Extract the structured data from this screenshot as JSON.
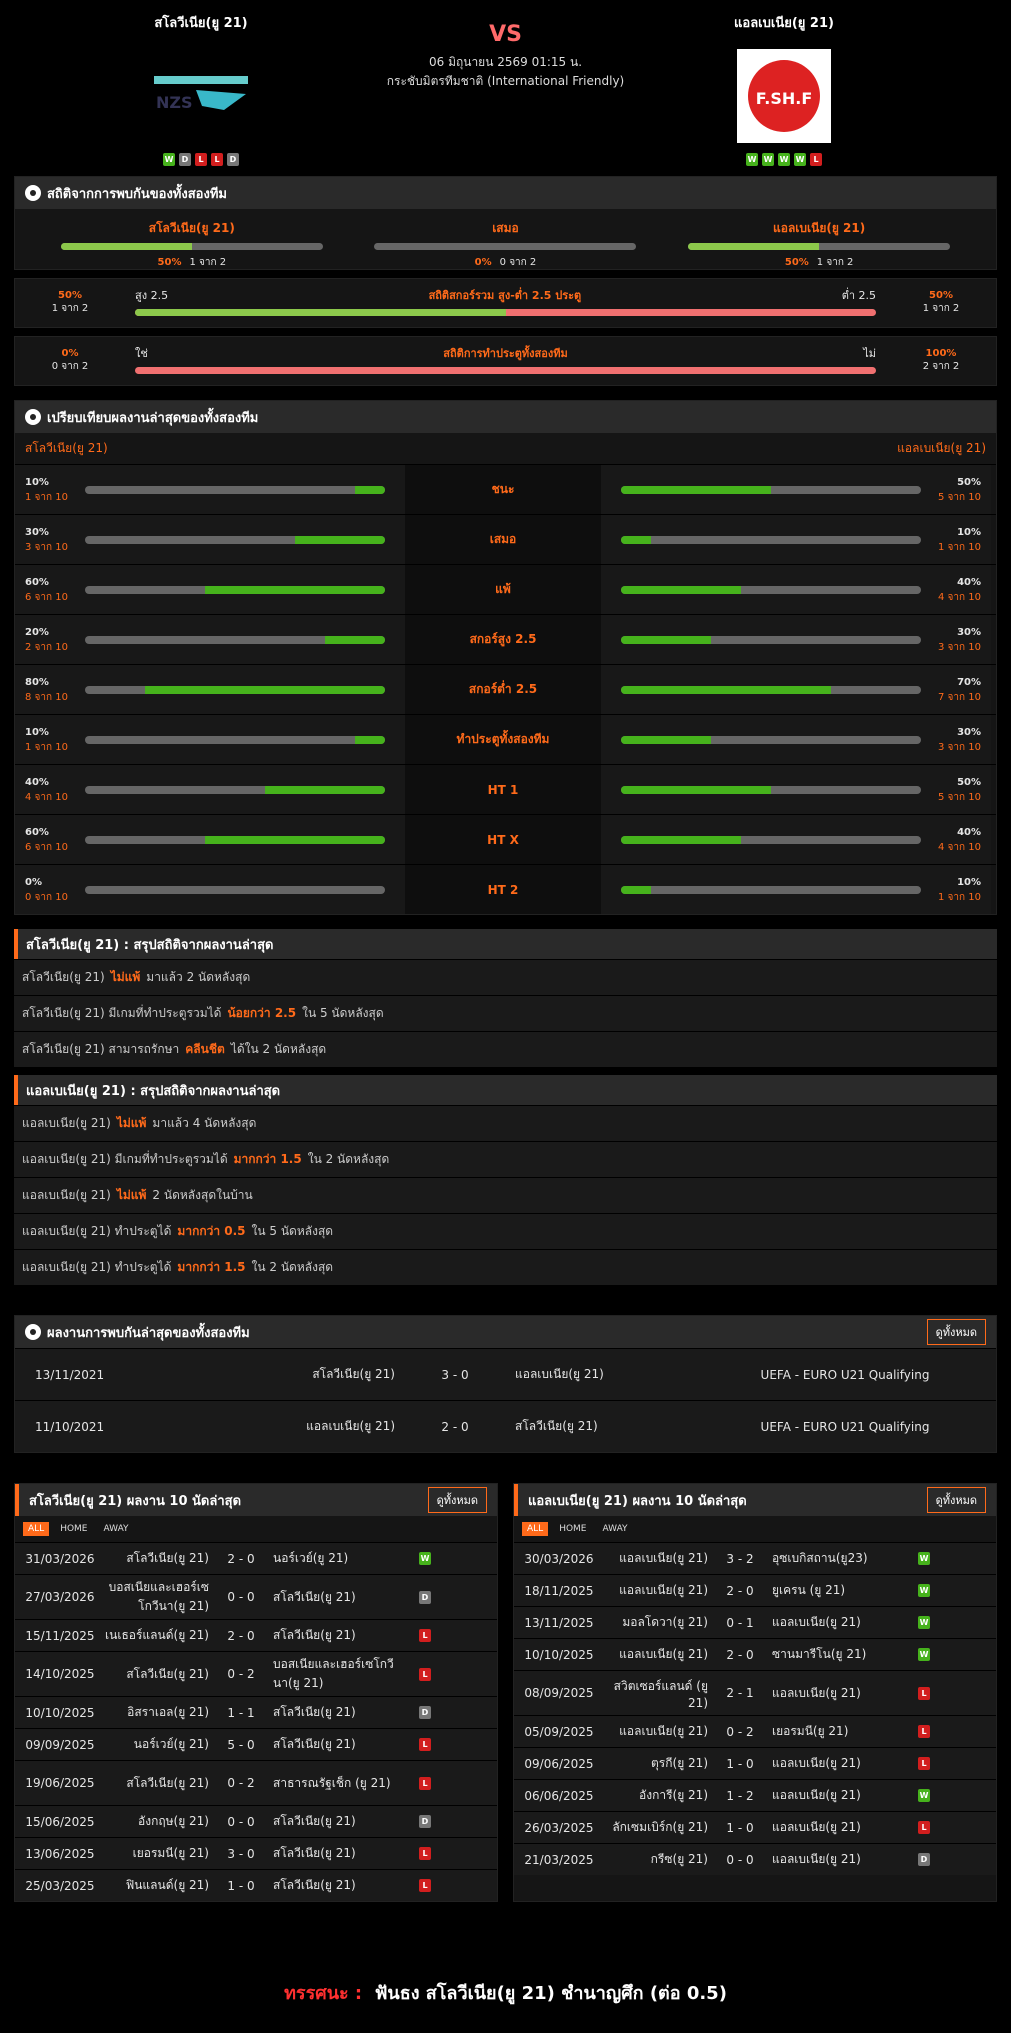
{
  "match": {
    "home": "สโลวีเนีย(ยู 21)",
    "away": "แอลเบเนีย(ยู 21)",
    "vs": "VS",
    "datetime": "06 มิถุนายน 2569 01:15 น.",
    "league": "กระชับมิตรทีมชาติ (International Friendly)",
    "home_logo_text": "NZS",
    "away_logo_text": "F.SH.F",
    "home_form": [
      "W",
      "D",
      "L",
      "L",
      "D"
    ],
    "away_form": [
      "W",
      "W",
      "W",
      "W",
      "L"
    ]
  },
  "h2h_stats": {
    "title": "สถิติจากการพบกันของทั้งสองทีม",
    "cols": [
      {
        "label": "สโลวีเนีย(ยู 21)",
        "pct": "50%",
        "sub": "1 จาก 2",
        "fill": 0.5
      },
      {
        "label": "เสมอ",
        "pct": "0%",
        "sub": "0 จาก 2",
        "fill": 0
      },
      {
        "label": "แอลเบเนีย(ยู 21)",
        "pct": "50%",
        "sub": "1 จาก 2",
        "fill": 0.5
      }
    ],
    "ou": {
      "left_pct": "50%",
      "left_sub": "1 จาก 2",
      "right_pct": "50%",
      "right_sub": "1 จาก 2",
      "l": "สูง 2.5",
      "title": "สถิติสกอร์รวม สูง-ต่ำ 2.5 ประตู",
      "r": "ต่ำ 2.5",
      "fill": 0.5
    },
    "btts": {
      "left_pct": "0%",
      "left_sub": "0 จาก 2",
      "right_pct": "100%",
      "right_sub": "2 จาก 2",
      "l": "ใช่",
      "title": "สถิติการทำประตูทั้งสองทีม",
      "r": "ไม่",
      "fill": 0
    }
  },
  "compare": {
    "title": "เปรียบเทียบผลงานล่าสุดของทั้งสองทีม",
    "home": "สโลวีเนีย(ยู 21)",
    "away": "แอลเบเนีย(ยู 21)",
    "rows": [
      {
        "label": "ชนะ",
        "hp": "10%",
        "hs": "1 จาก 10",
        "hv": 0.1,
        "ap": "50%",
        "as": "5 จาก 10",
        "av": 0.5
      },
      {
        "label": "เสมอ",
        "hp": "30%",
        "hs": "3 จาก 10",
        "hv": 0.3,
        "ap": "10%",
        "as": "1 จาก 10",
        "av": 0.1
      },
      {
        "label": "แพ้",
        "hp": "60%",
        "hs": "6 จาก 10",
        "hv": 0.6,
        "ap": "40%",
        "as": "4 จาก 10",
        "av": 0.4
      },
      {
        "label": "สกอร์สูง 2.5",
        "hp": "20%",
        "hs": "2 จาก 10",
        "hv": 0.2,
        "ap": "30%",
        "as": "3 จาก 10",
        "av": 0.3
      },
      {
        "label": "สกอร์ต่ำ 2.5",
        "hp": "80%",
        "hs": "8 จาก 10",
        "hv": 0.8,
        "ap": "70%",
        "as": "7 จาก 10",
        "av": 0.7
      },
      {
        "label": "ทำประตูทั้งสองทีม",
        "hp": "10%",
        "hs": "1 จาก 10",
        "hv": 0.1,
        "ap": "30%",
        "as": "3 จาก 10",
        "av": 0.3
      },
      {
        "label": "HT 1",
        "hp": "40%",
        "hs": "4 จาก 10",
        "hv": 0.4,
        "ap": "50%",
        "as": "5 จาก 10",
        "av": 0.5
      },
      {
        "label": "HT X",
        "hp": "60%",
        "hs": "6 จาก 10",
        "hv": 0.6,
        "ap": "40%",
        "as": "4 จาก 10",
        "av": 0.4
      },
      {
        "label": "HT 2",
        "hp": "0%",
        "hs": "0 จาก 10",
        "hv": 0,
        "ap": "10%",
        "as": "1 จาก 10",
        "av": 0.1
      }
    ]
  },
  "summary_home": {
    "title": "สโลวีเนีย(ยู 21) : สรุปสถิติจากผลงานล่าสุด",
    "lines": [
      {
        "a": "สโลวีเนีย(ยู 21)",
        "h": "ไม่แพ้",
        "b": "มาแล้ว 2 นัดหลังสุด"
      },
      {
        "a": "สโลวีเนีย(ยู 21)  มีเกมที่ทำประตูรวมได้",
        "h": "น้อยกว่า  2.5",
        "b": "ใน 5 นัดหลังสุด"
      },
      {
        "a": "สโลวีเนีย(ยู 21)  สามารถรักษา",
        "h": "คลีนชีต",
        "b": "ได้ใน 2 นัดหลังสุด"
      }
    ]
  },
  "summary_away": {
    "title": "แอลเบเนีย(ยู 21) : สรุปสถิติจากผลงานล่าสุด",
    "lines": [
      {
        "a": "แอลเบเนีย(ยู 21)",
        "h": "ไม่แพ้",
        "b": "มาแล้ว 4 นัดหลังสุด"
      },
      {
        "a": "แอลเบเนีย(ยู 21)  มีเกมที่ทำประตูรวมได้",
        "h": "มากกว่า  1.5",
        "b": "ใน 2 นัดหลังสุด"
      },
      {
        "a": "แอลเบเนีย(ยู 21)",
        "h": "ไม่แพ้",
        "b": "2  นัดหลังสุดในบ้าน"
      },
      {
        "a": "แอลเบเนีย(ยู 21)  ทำประตูได้",
        "h": "มากกว่า  0.5",
        "b": "ใน 5 นัดหลังสุด"
      },
      {
        "a": "แอลเบเนีย(ยู 21)  ทำประตูได้",
        "h": "มากกว่า  1.5",
        "b": "ใน 2 นัดหลังสุด"
      }
    ]
  },
  "h2h": {
    "title": "ผลงานการพบกันล่าสุดของทั้งสองทีม",
    "btn": "ดูทั้งหมด",
    "rows": [
      {
        "date": "13/11/2021",
        "home": "สโลวีเนีย(ยู 21)",
        "score": "3 - 0",
        "away": "แอลเบเนีย(ยู 21)",
        "comp": "UEFA - EURO U21 Qualifying"
      },
      {
        "date": "11/10/2021",
        "home": "แอลเบเนีย(ยู 21)",
        "score": "2 - 0",
        "away": "สโลวีเนีย(ยู 21)",
        "comp": "UEFA - EURO U21 Qualifying"
      }
    ]
  },
  "last_home": {
    "title": "สโลวีเนีย(ยู 21) ผลงาน 10 นัดล่าสุด",
    "btn": "ดูทั้งหมด",
    "tabs": [
      "ALL",
      "HOME",
      "AWAY"
    ],
    "rows": [
      {
        "d": "31/03/2026",
        "h": "สโลวีเนีย(ยู 21)",
        "s": "2 - 0",
        "a": "นอร์เวย์(ยู 21)",
        "r": "W"
      },
      {
        "d": "27/03/2026",
        "h": "บอสเนียและเฮอร์เซโกวีนา(ยู 21)",
        "s": "0 - 0",
        "a": "สโลวีเนีย(ยู 21)",
        "r": "D"
      },
      {
        "d": "15/11/2025",
        "h": "เนเธอร์แลนด์(ยู 21)",
        "s": "2 - 0",
        "a": "สโลวีเนีย(ยู 21)",
        "r": "L"
      },
      {
        "d": "14/10/2025",
        "h": "สโลวีเนีย(ยู 21)",
        "s": "0 - 2",
        "a": "บอสเนียและเฮอร์เซโกวีนา(ยู 21)",
        "r": "L"
      },
      {
        "d": "10/10/2025",
        "h": "อิสราเอล(ยู 21)",
        "s": "1 - 1",
        "a": "สโลวีเนีย(ยู 21)",
        "r": "D"
      },
      {
        "d": "09/09/2025",
        "h": "นอร์เวย์(ยู 21)",
        "s": "5 - 0",
        "a": "สโลวีเนีย(ยู 21)",
        "r": "L"
      },
      {
        "d": "19/06/2025",
        "h": "สโลวีเนีย(ยู 21)",
        "s": "0 - 2",
        "a": "สาธารณรัฐเช็ก (ยู 21)",
        "r": "L"
      },
      {
        "d": "15/06/2025",
        "h": "อังกฤษ(ยู 21)",
        "s": "0 - 0",
        "a": "สโลวีเนีย(ยู 21)",
        "r": "D"
      },
      {
        "d": "13/06/2025",
        "h": "เยอรมนี(ยู 21)",
        "s": "3 - 0",
        "a": "สโลวีเนีย(ยู 21)",
        "r": "L"
      },
      {
        "d": "25/03/2025",
        "h": "ฟินแลนด์(ยู 21)",
        "s": "1 - 0",
        "a": "สโลวีเนีย(ยู 21)",
        "r": "L"
      }
    ]
  },
  "last_away": {
    "title": "แอลเบเนีย(ยู 21) ผลงาน 10 นัดล่าสุด",
    "btn": "ดูทั้งหมด",
    "tabs": [
      "ALL",
      "HOME",
      "AWAY"
    ],
    "rows": [
      {
        "d": "30/03/2026",
        "h": "แอลเบเนีย(ยู 21)",
        "s": "3 - 2",
        "a": "อุซเบกิสถาน(ยู23)",
        "r": "W"
      },
      {
        "d": "18/11/2025",
        "h": "แอลเบเนีย(ยู 21)",
        "s": "2 - 0",
        "a": "ยูเครน (ยู 21)",
        "r": "W"
      },
      {
        "d": "13/11/2025",
        "h": "มอลโดวา(ยู 21)",
        "s": "0 - 1",
        "a": "แอลเบเนีย(ยู 21)",
        "r": "W"
      },
      {
        "d": "10/10/2025",
        "h": "แอลเบเนีย(ยู 21)",
        "s": "2 - 0",
        "a": "ซานมารีโน(ยู 21)",
        "r": "W"
      },
      {
        "d": "08/09/2025",
        "h": "สวิตเซอร์แลนด์ (ยู 21)",
        "s": "2 - 1",
        "a": "แอลเบเนีย(ยู 21)",
        "r": "L"
      },
      {
        "d": "05/09/2025",
        "h": "แอลเบเนีย(ยู 21)",
        "s": "0 - 2",
        "a": "เยอรมนี(ยู 21)",
        "r": "L"
      },
      {
        "d": "09/06/2025",
        "h": "ตุรกี(ยู 21)",
        "s": "1 - 0",
        "a": "แอลเบเนีย(ยู 21)",
        "r": "L"
      },
      {
        "d": "06/06/2025",
        "h": "อังการี(ยู 21)",
        "s": "1 - 2",
        "a": "แอลเบเนีย(ยู 21)",
        "r": "W"
      },
      {
        "d": "26/03/2025",
        "h": "ลักเซมเบิร์ก(ยู 21)",
        "s": "1 - 0",
        "a": "แอลเบเนีย(ยู 21)",
        "r": "L"
      },
      {
        "d": "21/03/2025",
        "h": "กรีซ(ยู 21)",
        "s": "0 - 0",
        "a": "แอลเบเนีย(ยู 21)",
        "r": "D"
      }
    ]
  },
  "verdict": {
    "label": "ทรรศนะ :",
    "text": "ฟันธง สโลวีเนีย(ยู 21) ชำนาญศึก (ต่อ 0.5)"
  }
}
